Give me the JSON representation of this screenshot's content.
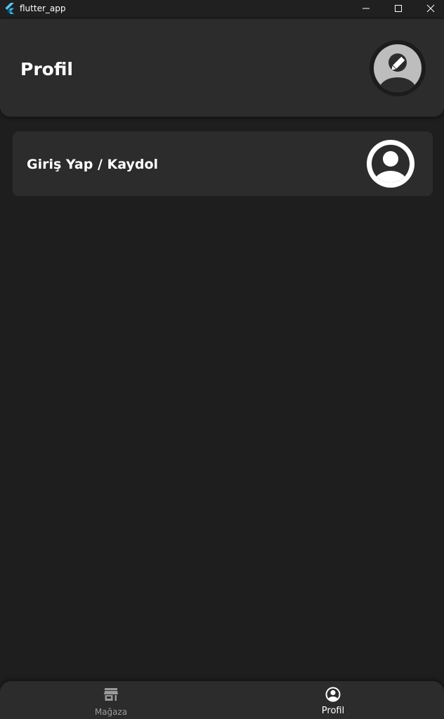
{
  "window": {
    "title": "flutter_app",
    "controls": {
      "minimize_icon": "minimize-icon",
      "maximize_icon": "maximize-icon",
      "close_icon": "close-icon"
    }
  },
  "header": {
    "title": "Profil",
    "avatar_icon": "account-edit-icon"
  },
  "login": {
    "label": "Giriş Yap / Kaydol",
    "icon": "account-circle-icon"
  },
  "bottom_nav": {
    "items": [
      {
        "label": "Mağaza",
        "icon": "store-icon",
        "active": false
      },
      {
        "label": "Profil",
        "icon": "account-circle-icon",
        "active": true
      }
    ]
  },
  "colors": {
    "background": "#1e1e1e",
    "surface": "#2c2c2c",
    "titlebar": "#202020",
    "text": "#ffffff",
    "inactive": "#9a9a9a",
    "avatar_bg": "#bdbdbd"
  }
}
